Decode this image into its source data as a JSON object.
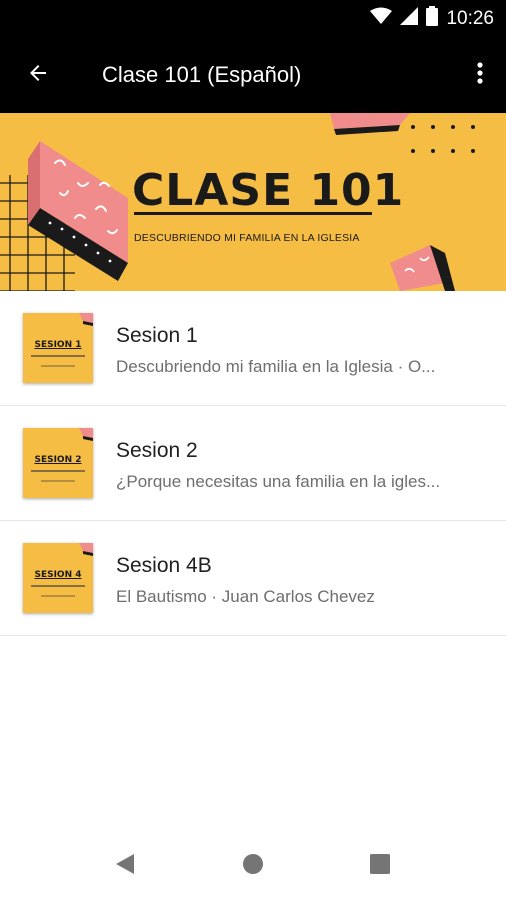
{
  "status_bar": {
    "time": "10:26"
  },
  "app_bar": {
    "title": "Clase 101 (Español)"
  },
  "banner": {
    "title": "CLASE 101",
    "subtitle": "DESCUBRIENDO MI FAMILIA EN LA IGLESIA"
  },
  "colors": {
    "banner_bg": "#f6bd44",
    "pink": "#f08c8c",
    "dark": "#1a1a1a"
  },
  "items": [
    {
      "title": "Sesion 1",
      "subtitle": "Descubriendo mi familia en la Iglesia · O...",
      "thumb_label": "SESION 1"
    },
    {
      "title": "Sesion 2",
      "subtitle": "¿Porque necesitas una familia en la igles...",
      "thumb_label": "SESION 2"
    },
    {
      "title": "Sesion 4B",
      "subtitle": "El Bautismo · Juan Carlos Chevez",
      "thumb_label": "SESION 4"
    }
  ],
  "icons": {
    "back": "arrow-back-icon",
    "more": "more-vert-icon",
    "wifi": "wifi-icon",
    "signal": "signal-icon",
    "battery": "battery-icon"
  }
}
